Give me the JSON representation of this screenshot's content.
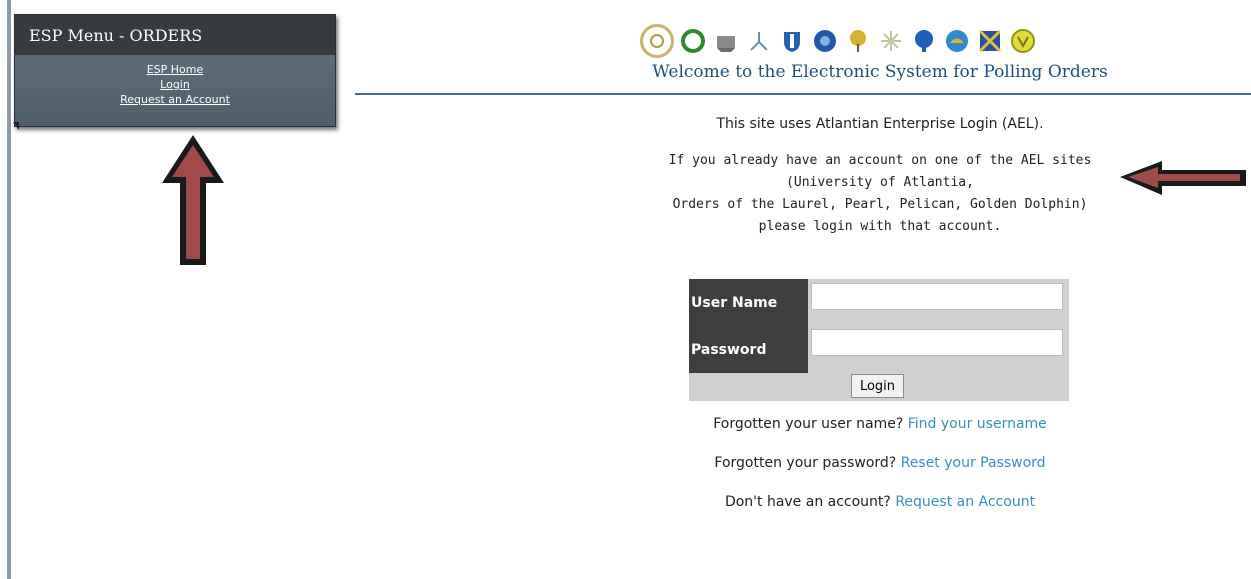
{
  "menu": {
    "title": "ESP Menu - ORDERS",
    "links": [
      "ESP Home",
      "Login",
      "Request an Account"
    ]
  },
  "header": {
    "title": "Welcome to the Electronic System for Polling Orders",
    "logos": [
      "order-logo-1",
      "order-logo-2",
      "order-logo-3",
      "order-logo-4",
      "order-logo-5",
      "order-logo-6",
      "order-logo-7",
      "order-logo-8",
      "order-logo-9",
      "order-logo-10",
      "order-logo-11",
      "order-logo-12"
    ]
  },
  "intro": {
    "text_before": "This site uses ",
    "ael": "Atlantian Enterprise Login (AEL)."
  },
  "info_lines": [
    "If you already have an account on one of the AEL sites",
    "(University of Atlantia,",
    "Orders of the Laurel, Pearl, Pelican, Golden Dolphin)",
    "please login with that account."
  ],
  "form": {
    "username_label": "User Name",
    "password_label": "Password",
    "username_value": "",
    "password_value": "",
    "login_button": "Login"
  },
  "help": {
    "username_prefix": "Forgotten your user name?",
    "username_link": "Find your username",
    "password_prefix": "Forgotten your password?",
    "password_link": "Reset your Password",
    "account_prefix": "Don't have an account?",
    "account_link": "Request an Account"
  },
  "colors": {
    "accent": "#3a8fb8",
    "title": "#1f4f7a",
    "arrow_fill": "#a14a4a"
  }
}
